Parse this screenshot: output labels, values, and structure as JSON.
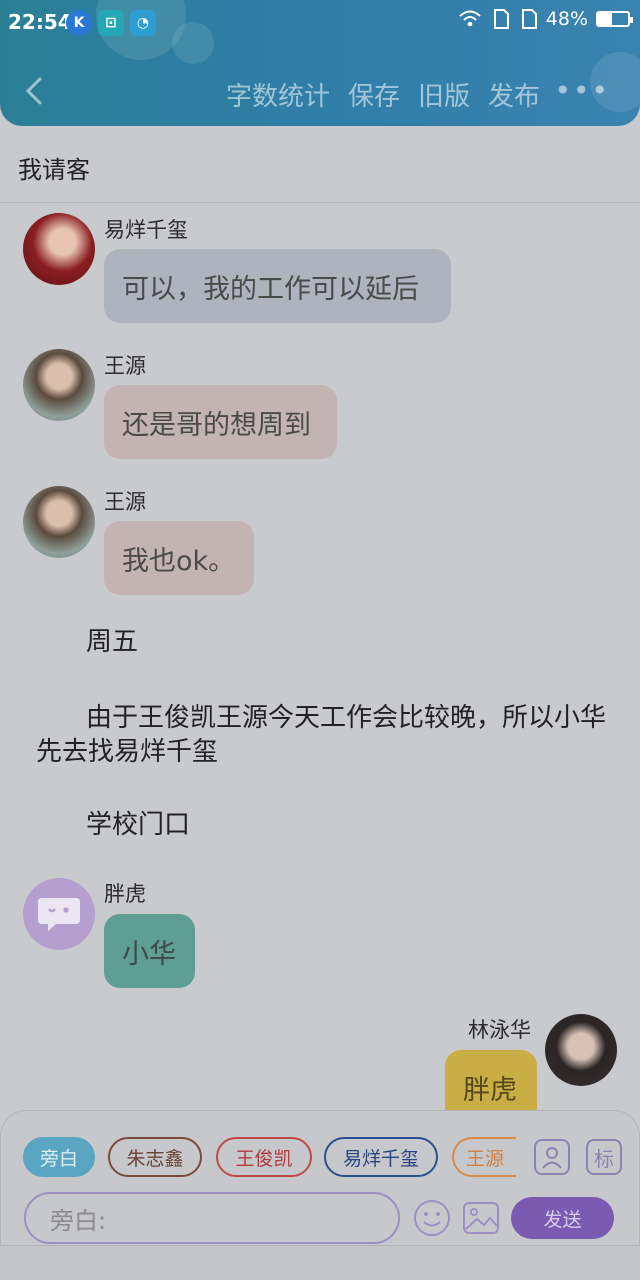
{
  "status": {
    "time": "22:54",
    "battery": "48%",
    "battery_level": 0.48,
    "apps": [
      "K",
      "⊡",
      "◔"
    ]
  },
  "nav": {
    "actions": [
      "字数统计",
      "保存",
      "旧版",
      "发布"
    ],
    "more": "•••"
  },
  "page_title": "我请客",
  "messages": [
    {
      "name": "易烊千玺",
      "text": "可以，我的工作可以延后"
    },
    {
      "name": "王源",
      "text": "还是哥的想周到"
    },
    {
      "name": "王源",
      "text": "我也ok。"
    }
  ],
  "narration": [
    "周五",
    "由于王俊凯王源今天工作会比较晚，所以小华先去找易烊千玺",
    "学校门口"
  ],
  "messages2": [
    {
      "name": "胖虎",
      "text": "小华"
    },
    {
      "name": "林泳华",
      "text": "胖虎"
    }
  ],
  "characters": [
    {
      "label": "旁白",
      "color": "#5aa6c2"
    },
    {
      "label": "朱志鑫",
      "color": "#7a4b3c"
    },
    {
      "label": "王俊凯",
      "color": "#c0484a"
    },
    {
      "label": "易烊千玺",
      "color": "#2c4f8f"
    },
    {
      "label": "王源",
      "color": "#d98a4a"
    }
  ],
  "tool_mark": "标",
  "input": {
    "placeholder": "旁白:"
  },
  "send_label": "发送"
}
